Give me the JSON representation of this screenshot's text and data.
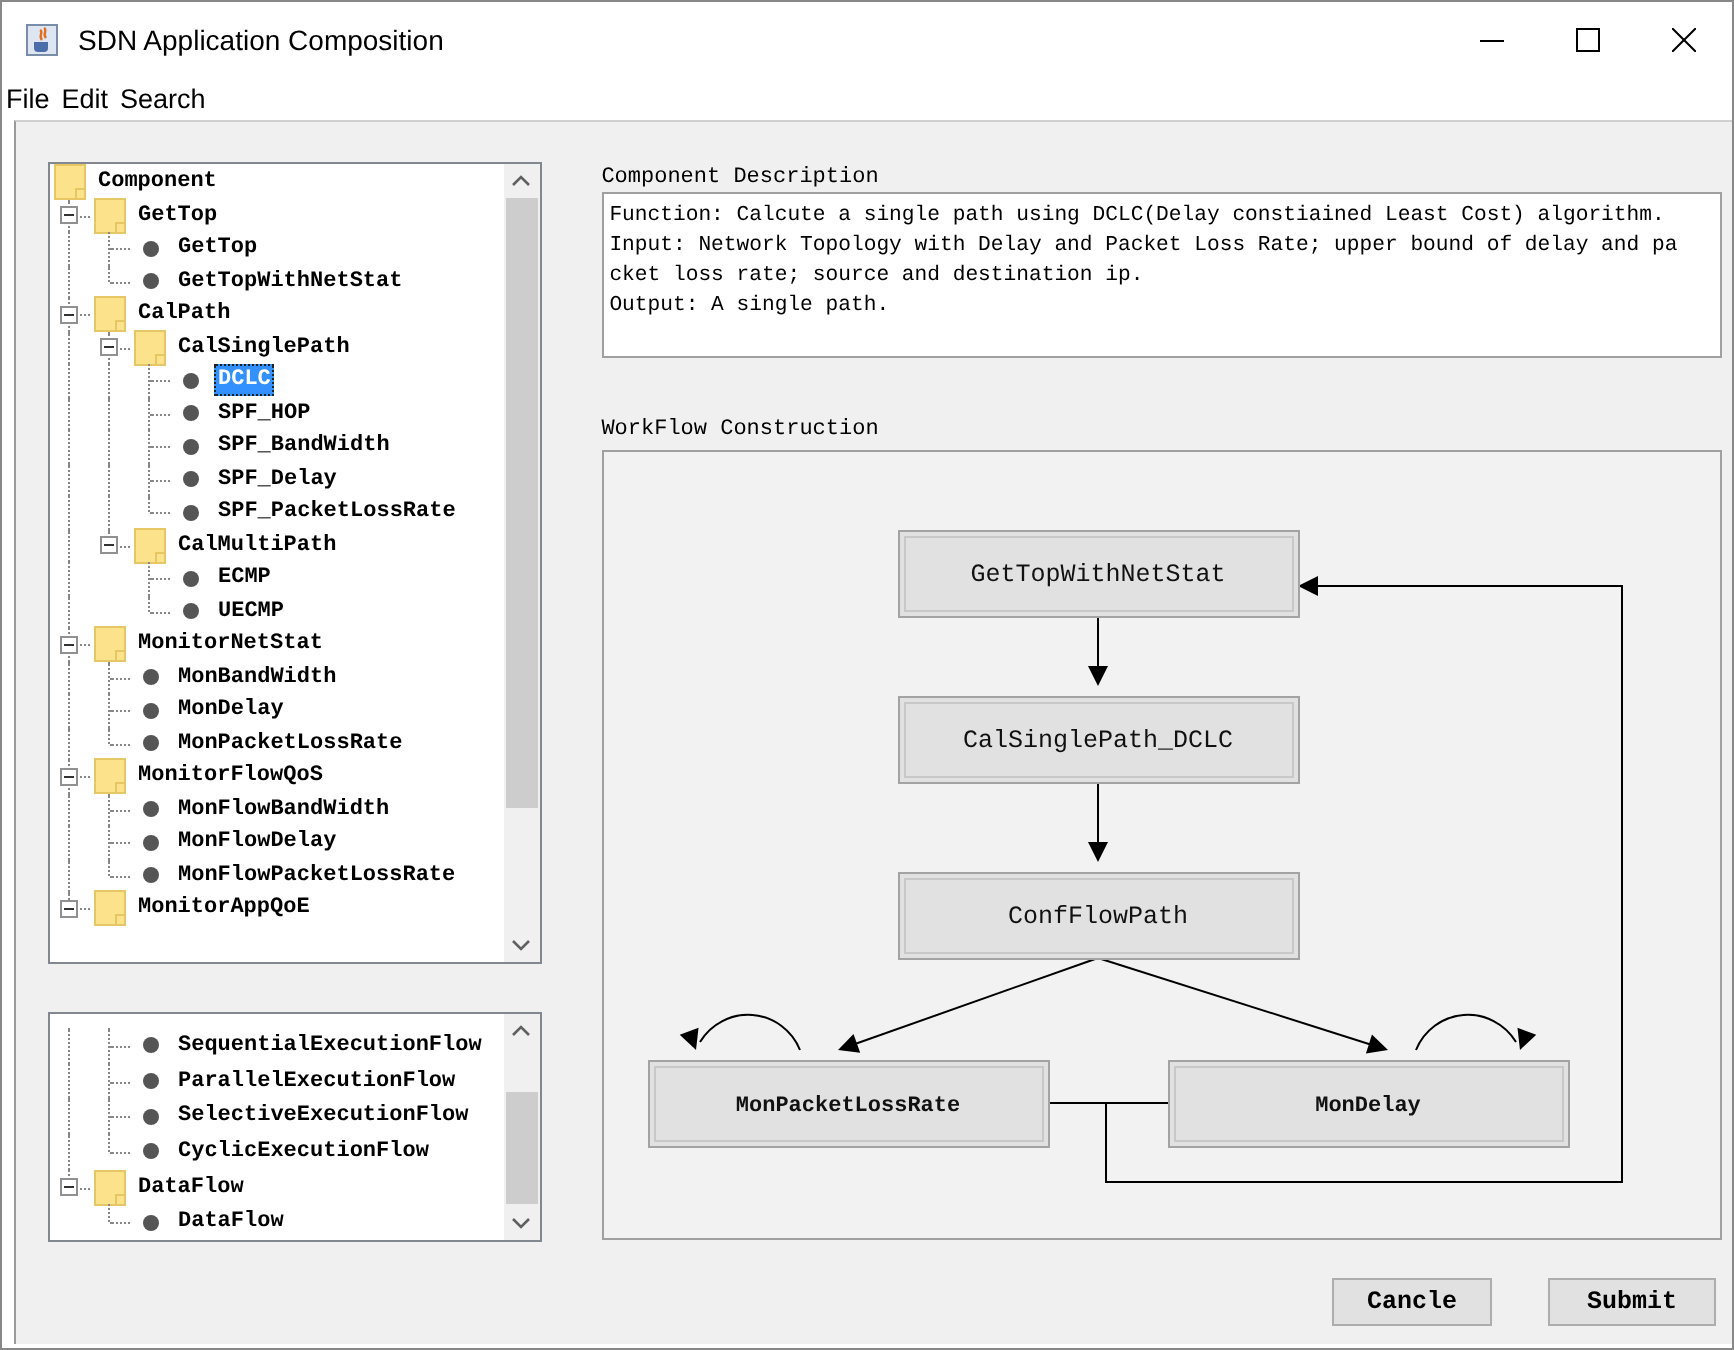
{
  "window": {
    "title": "SDN Application Composition"
  },
  "menu_bar": [
    "File",
    "Edit",
    "Search"
  ],
  "component_tree": {
    "root": {
      "kind": "folder",
      "label": "Component",
      "children": [
        {
          "kind": "folder",
          "label": "GetTop",
          "expanded": true,
          "children": [
            {
              "kind": "leaf",
              "label": "GetTop",
              "selected": false
            },
            {
              "kind": "leaf",
              "label": "GetTopWithNetStat",
              "selected": false
            }
          ]
        },
        {
          "kind": "folder",
          "label": "CalPath",
          "expanded": true,
          "children": [
            {
              "kind": "folder",
              "label": "CalSinglePath",
              "expanded": true,
              "children": [
                {
                  "kind": "leaf",
                  "label": "DCLC",
                  "selected": true
                },
                {
                  "kind": "leaf",
                  "label": "SPF_HOP",
                  "selected": false
                },
                {
                  "kind": "leaf",
                  "label": "SPF_BandWidth",
                  "selected": false
                },
                {
                  "kind": "leaf",
                  "label": "SPF_Delay",
                  "selected": false
                },
                {
                  "kind": "leaf",
                  "label": "SPF_PacketLossRate",
                  "selected": false
                }
              ]
            },
            {
              "kind": "folder",
              "label": "CalMultiPath",
              "expanded": true,
              "children": [
                {
                  "kind": "leaf",
                  "label": "ECMP",
                  "selected": false
                },
                {
                  "kind": "leaf",
                  "label": "UECMP",
                  "selected": false
                }
              ]
            }
          ]
        },
        {
          "kind": "folder",
          "label": "MonitorNetStat",
          "expanded": true,
          "children": [
            {
              "kind": "leaf",
              "label": "MonBandWidth",
              "selected": false
            },
            {
              "kind": "leaf",
              "label": "MonDelay",
              "selected": false
            },
            {
              "kind": "leaf",
              "label": "MonPacketLossRate",
              "selected": false
            }
          ]
        },
        {
          "kind": "folder",
          "label": "MonitorFlowQoS",
          "expanded": true,
          "children": [
            {
              "kind": "leaf",
              "label": "MonFlowBandWidth",
              "selected": false
            },
            {
              "kind": "leaf",
              "label": "MonFlowDelay",
              "selected": false
            },
            {
              "kind": "leaf",
              "label": "MonFlowPacketLossRate",
              "selected": false
            }
          ]
        },
        {
          "kind": "folder",
          "label": "MonitorAppQoE",
          "expanded": true
        }
      ]
    }
  },
  "execution_tree": {
    "items": [
      {
        "kind": "leaf",
        "label": "SequentialExecutionFlow",
        "selected": false
      },
      {
        "kind": "leaf",
        "label": "ParallelExecutionFlow",
        "selected": false
      },
      {
        "kind": "leaf",
        "label": "SelectiveExecutionFlow",
        "selected": false
      },
      {
        "kind": "leaf",
        "label": "CyclicExecutionFlow",
        "selected": false
      },
      {
        "kind": "folder",
        "label": "DataFlow",
        "expanded": true,
        "children": [
          {
            "kind": "leaf",
            "label": "DataFlow",
            "selected": false
          }
        ]
      }
    ]
  },
  "description": {
    "title": "Component Description",
    "lines": [
      "Function: Calcute a single path using DCLC(Delay constiained Least Cost) algorithm.",
      "Input: Network Topology with Delay and Packet Loss Rate; upper bound of delay and pa",
      "cket loss rate; source and destination ip.",
      "Output: A single path."
    ]
  },
  "workflow": {
    "title": "WorkFlow Construction",
    "nodes": [
      {
        "label": "GetTopWithNetStat",
        "kind": "process",
        "self_loop": false
      },
      {
        "label": "CalSinglePath_DCLC",
        "kind": "process",
        "self_loop": false
      },
      {
        "label": "ConfFlowPath",
        "kind": "process",
        "self_loop": false
      },
      {
        "label": "MonPacketLossRate",
        "kind": "monitor",
        "self_loop": true
      },
      {
        "label": "MonDelay",
        "kind": "monitor",
        "self_loop": true
      }
    ]
  },
  "buttons": [
    "Cancle",
    "Submit"
  ]
}
